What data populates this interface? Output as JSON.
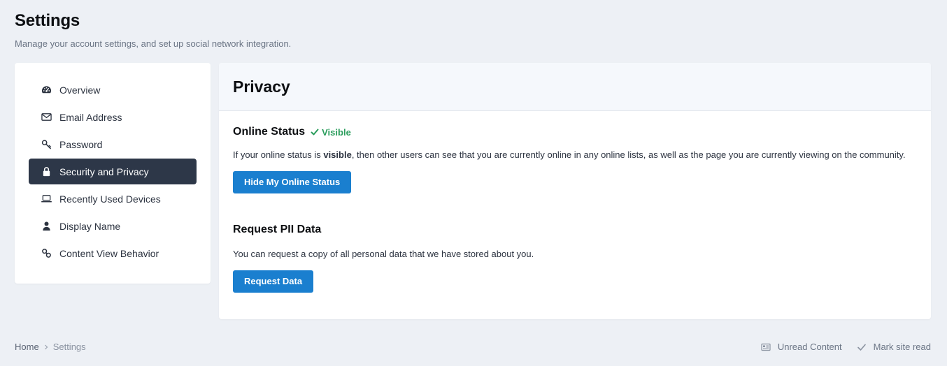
{
  "header": {
    "title": "Settings",
    "subtitle": "Manage your account settings, and set up social network integration."
  },
  "sidebar": {
    "items": [
      {
        "label": "Overview",
        "icon": "gauge-icon",
        "active": false
      },
      {
        "label": "Email Address",
        "icon": "envelope-icon",
        "active": false
      },
      {
        "label": "Password",
        "icon": "key-icon",
        "active": false
      },
      {
        "label": "Security and Privacy",
        "icon": "lock-icon",
        "active": true
      },
      {
        "label": "Recently Used Devices",
        "icon": "laptop-icon",
        "active": false
      },
      {
        "label": "Display Name",
        "icon": "user-icon",
        "active": false
      },
      {
        "label": "Content View Behavior",
        "icon": "link-icon",
        "active": false
      }
    ]
  },
  "main": {
    "title": "Privacy",
    "online_status": {
      "title": "Online Status",
      "badge": "Visible",
      "badge_color": "#2a9d5c",
      "text_before": "If your online status is ",
      "text_bold": "visible",
      "text_after": ", then other users can see that you are currently online in any online lists, as well as the page you are currently viewing on the community.",
      "button": "Hide My Online Status"
    },
    "pii": {
      "title": "Request PII Data",
      "text": "You can request a copy of all personal data that we have stored about you.",
      "button": "Request Data"
    }
  },
  "footer": {
    "breadcrumb_home": "Home",
    "breadcrumb_current": "Settings",
    "unread_content": "Unread Content",
    "mark_site_read": "Mark site read"
  },
  "colors": {
    "accent": "#1a7fcf",
    "active_nav": "#2d3748",
    "background": "#edf0f5"
  }
}
